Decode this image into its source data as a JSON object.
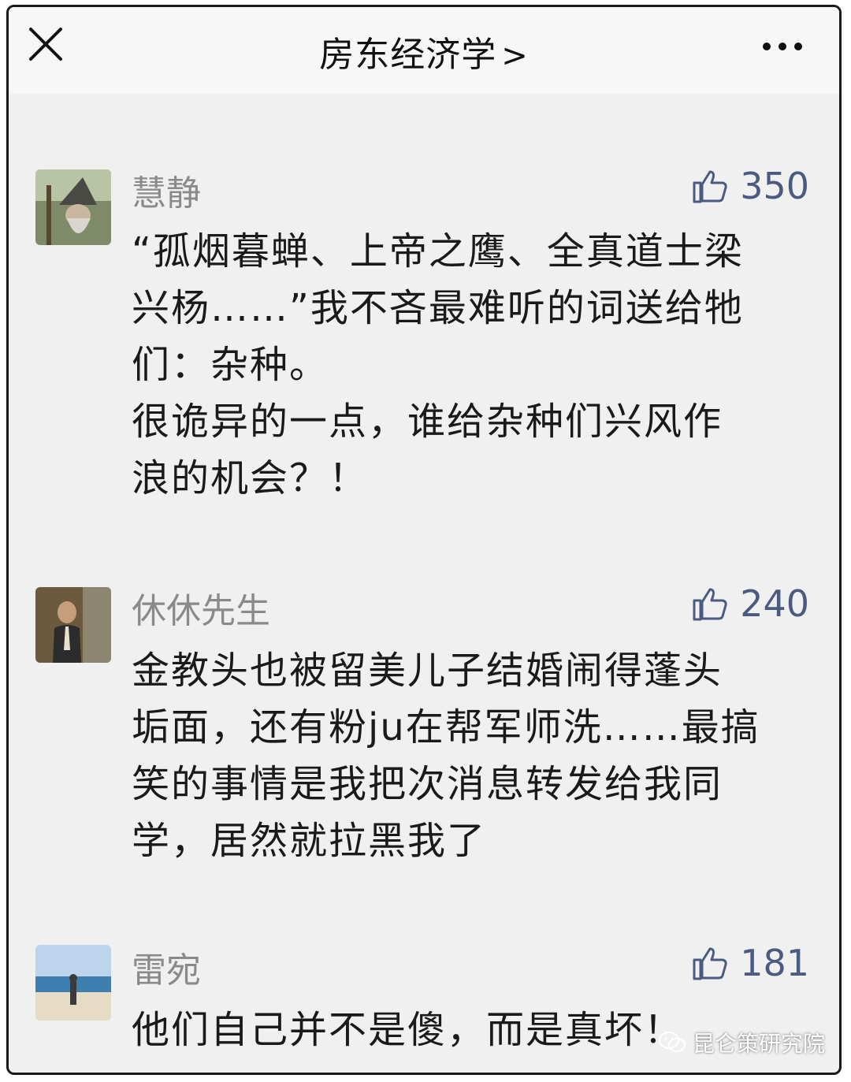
{
  "header": {
    "title": "房东经济学",
    "chevron": ">",
    "close_icon": "close-icon",
    "more_icon": "more-dots-icon"
  },
  "comments": [
    {
      "name": "慧静",
      "likes": "350",
      "lines": [
        "“孤烟暮蝉、上帝之鹰、全真道士梁",
        "兴杨……”我不吝最难听的词送给牠",
        "们：杂种。",
        "很诡异的一点，谁给杂种们兴风作",
        "浪的机会？！"
      ]
    },
    {
      "name": "休休先生",
      "likes": "240",
      "lines": [
        "金教头也被留美儿子结婚闹得蓬头",
        "垢面，还有粉ju在帮军师洗……最搞",
        "笑的事情是我把次消息转发给我同",
        "学，居然就拉黑我了"
      ]
    },
    {
      "name": "雷宛",
      "likes": "181",
      "lines": [
        "他们自己并不是傻，而是真坏！"
      ]
    }
  ],
  "watermark": {
    "text": "昆仑策研究院",
    "icon": "wechat-icon"
  },
  "colors": {
    "background": "#f0f0f0",
    "name": "#8a8a8a",
    "likes": "#4a5a80",
    "text": "#1a1a1a"
  }
}
